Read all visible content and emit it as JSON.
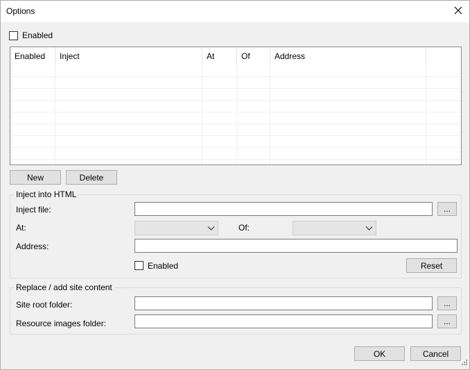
{
  "window": {
    "title": "Options"
  },
  "top_enabled": {
    "label": "Enabled",
    "checked": false
  },
  "grid": {
    "columns": [
      "Enabled",
      "Inject",
      "At",
      "Of",
      "Address"
    ],
    "rows": []
  },
  "grid_buttons": {
    "new_label": "New",
    "delete_label": "Delete"
  },
  "inject_group": {
    "title": "Inject into HTML",
    "inject_file_label": "Inject file:",
    "inject_file_value": "",
    "browse_label": "...",
    "at_label": "At:",
    "at_value": "",
    "of_label": "Of:",
    "of_value": "",
    "address_label": "Address:",
    "address_value": "",
    "enabled_label": "Enabled",
    "enabled_checked": false,
    "reset_label": "Reset"
  },
  "replace_group": {
    "title": "Replace / add site content",
    "site_root_label": "Site root folder:",
    "site_root_value": "",
    "resource_images_label": "Resource images folder:",
    "resource_images_value": "",
    "browse_label": "..."
  },
  "footer": {
    "ok_label": "OK",
    "cancel_label": "Cancel"
  }
}
